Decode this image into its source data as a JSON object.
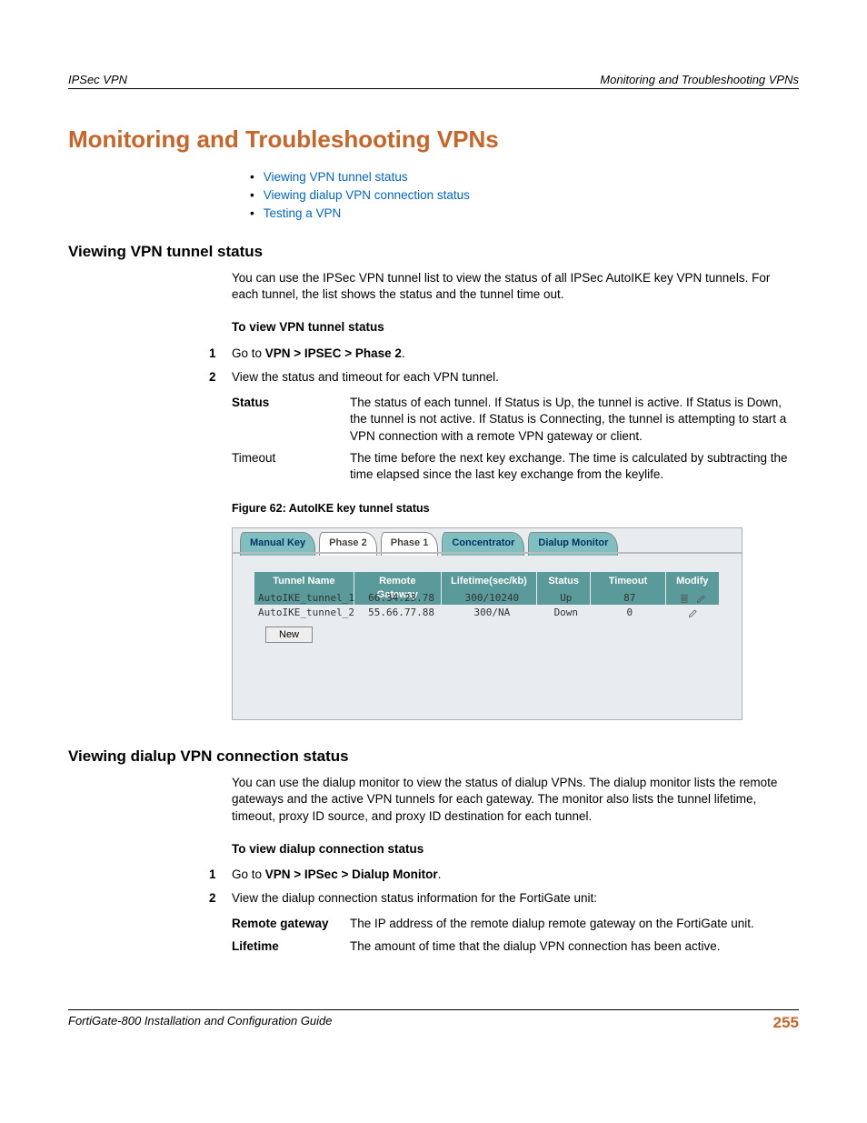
{
  "header": {
    "left": "IPSec VPN",
    "right": "Monitoring and Troubleshooting VPNs"
  },
  "title": "Monitoring and Troubleshooting VPNs",
  "toc": {
    "item1": "Viewing VPN tunnel status",
    "item2": "Viewing dialup VPN connection status",
    "item3": "Testing a VPN"
  },
  "sec1": {
    "heading": "Viewing VPN tunnel status",
    "intro": "You can use the IPSec VPN tunnel list to view the status of all IPSec AutoIKE key VPN tunnels. For each tunnel, the list shows the status and the tunnel time out.",
    "sub": "To view VPN tunnel status",
    "step1_pre": "Go to ",
    "step1_b": "VPN > IPSEC > Phase 2",
    "step1_post": ".",
    "step2": "View the status and timeout for each VPN tunnel.",
    "def_status_term": "Status",
    "def_status_val": "The status of each tunnel. If Status is Up, the tunnel is active. If Status is Down, the tunnel is not active. If Status is Connecting, the tunnel is attempting to start a VPN connection with a remote VPN gateway or client.",
    "def_timeout_term": "Timeout",
    "def_timeout_val": "The time before the next key exchange. The time is calculated by subtracting the time elapsed since the last key exchange from the keylife.",
    "fig_caption": "Figure 62: AutoIKE key tunnel status"
  },
  "screenshot": {
    "tabs": {
      "t1": "Manual Key",
      "t2": "Phase 2",
      "t3": "Phase 1",
      "t4": "Concentrator",
      "t5": "Dialup Monitor"
    },
    "cols": {
      "c1": "Tunnel Name",
      "c2": "Remote Gateway",
      "c3": "Lifetime(sec/kb)",
      "c4": "Status",
      "c5": "Timeout",
      "c6": "Modify"
    },
    "row1": {
      "name": "AutoIKE_tunnel_1",
      "gw": "66.34.23.78",
      "life": "300/10240",
      "status": "Up",
      "timeout": "87"
    },
    "row2": {
      "name": "AutoIKE_tunnel_2",
      "gw": "55.66.77.88",
      "life": "300/NA",
      "status": "Down",
      "timeout": "0"
    },
    "new_btn": "New"
  },
  "sec2": {
    "heading": "Viewing dialup VPN connection status",
    "intro": "You can use the dialup monitor to view the status of dialup VPNs. The dialup monitor lists the remote gateways and the active VPN tunnels for each gateway. The monitor also lists the tunnel lifetime, timeout, proxy ID source, and proxy ID destination for each tunnel.",
    "sub": "To view dialup connection status",
    "step1_pre": "Go to ",
    "step1_b": "VPN > IPSec > Dialup Monitor",
    "step1_post": ".",
    "step2": "View the dialup connection status information for the FortiGate unit:",
    "def_gw_term": "Remote gateway",
    "def_gw_val": "The IP address of the remote dialup remote gateway on the FortiGate unit.",
    "def_life_term": "Lifetime",
    "def_life_val": "The amount of time that the dialup VPN connection has been active."
  },
  "footer": {
    "left": "FortiGate-800 Installation and Configuration Guide",
    "right": "255"
  }
}
